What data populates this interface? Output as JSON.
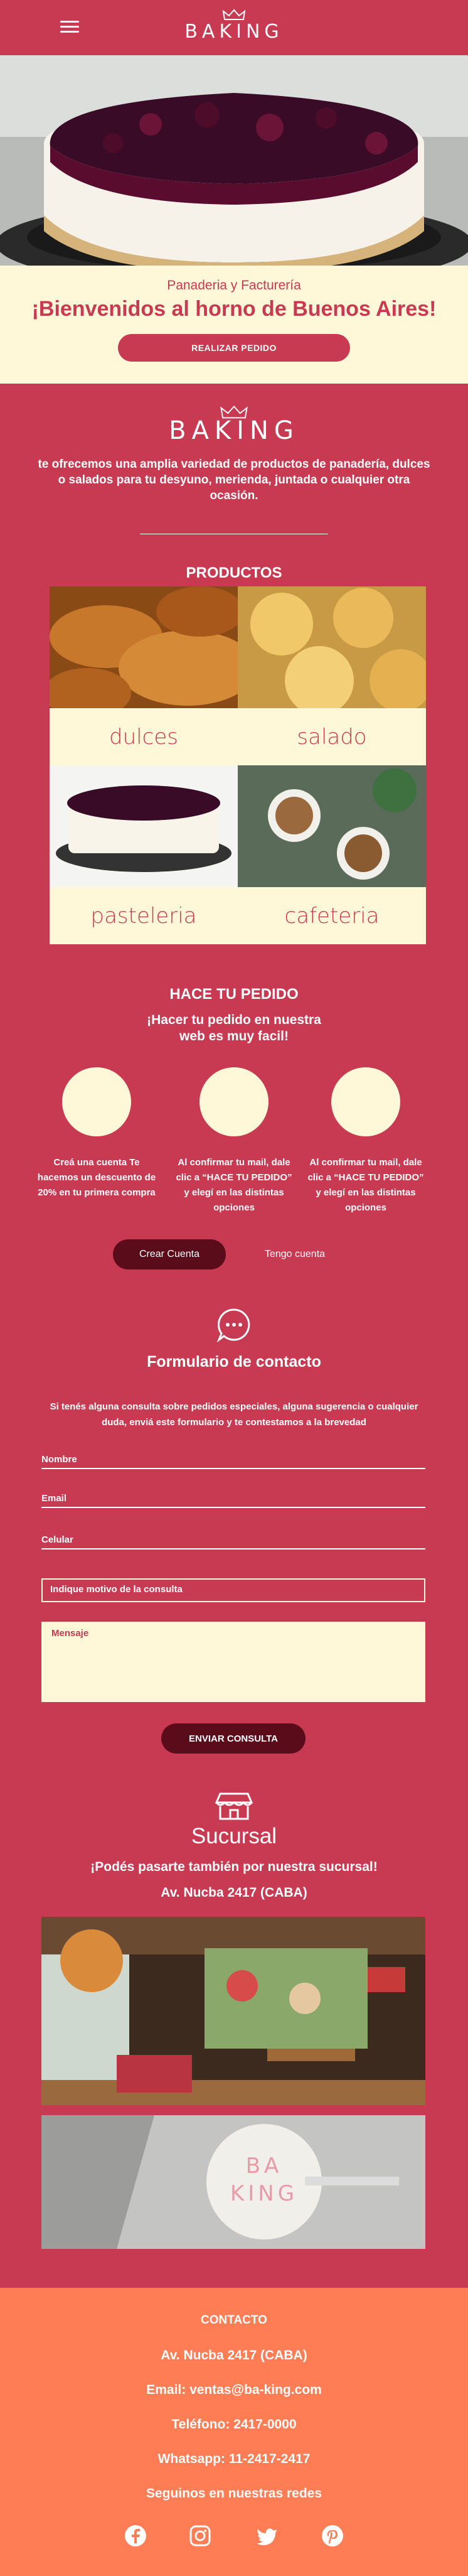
{
  "header": {
    "logo": "BAKING",
    "menu_icon": "hamburger-icon"
  },
  "hero": {
    "subtitle": "Panaderia y Facturería",
    "title": "¡Bienvenidos al horno de Buenos Aires!",
    "cta": "REALIZAR PEDIDO"
  },
  "about": {
    "logo": "BAKING",
    "text": "te ofrecemos una amplia variedad de productos de panadería, dulces o salados para tu desyuno, merienda, juntada o cualquier otra ocasión."
  },
  "products": {
    "title": "PRODUCTOS",
    "items": [
      {
        "label": "dulces"
      },
      {
        "label": "salado"
      },
      {
        "label": "pasteleria"
      },
      {
        "label": "cafeteria"
      }
    ]
  },
  "order": {
    "title": "HACE TU PEDIDO",
    "lead": "¡Hacer tu pedido en nuestra web es muy facil!",
    "steps": [
      "Creá una cuenta Te hacemos un descuento de 20% en tu primera compra",
      "Al confirmar tu mail, dale clic a “HACE TU PEDIDO” y elegí en las distintas opciones",
      "Al confirmar tu mail, dale clic a “HACE TU PEDIDO” y elegí en las distintas opciones"
    ],
    "create_account": "Crear Cuenta",
    "have_account": "Tengo cuenta"
  },
  "contact_form": {
    "title": "Formulario de contacto",
    "description": "Si tenés alguna consulta sobre pedidos especiales, alguna sugerencia o cualquier duda, enviá este formulario y te contestamos a la brevedad",
    "name_placeholder": "Nombre",
    "email_placeholder": "Email",
    "phone_placeholder": "Celular",
    "reason": "Indique motivo de la consulta",
    "message_placeholder": "Mensaje",
    "submit": "ENVIAR CONSULTA"
  },
  "branch": {
    "title": "Sucursal",
    "subtitle": "¡Podés pasarte también por nuestra sucursal!",
    "address": "Av. Nucba 2417 (CABA)",
    "sign_text": "BA KING"
  },
  "footer": {
    "title": "CONTACTO",
    "address": "Av. Nucba 2417 (CABA)",
    "email": "Email: ventas@ba-king.com",
    "phone": "Teléfono: 2417-0000",
    "whatsapp": "Whatsapp: 11-2417-2417",
    "social_title": "Seguinos en nuestras redes",
    "social_icons": [
      "facebook-icon",
      "instagram-icon",
      "twitter-icon",
      "pinterest-icon"
    ]
  },
  "colors": {
    "primary": "#c83a52",
    "cream": "#fef8d8",
    "dark": "#5a0c1a",
    "footer": "#fe7d55"
  }
}
